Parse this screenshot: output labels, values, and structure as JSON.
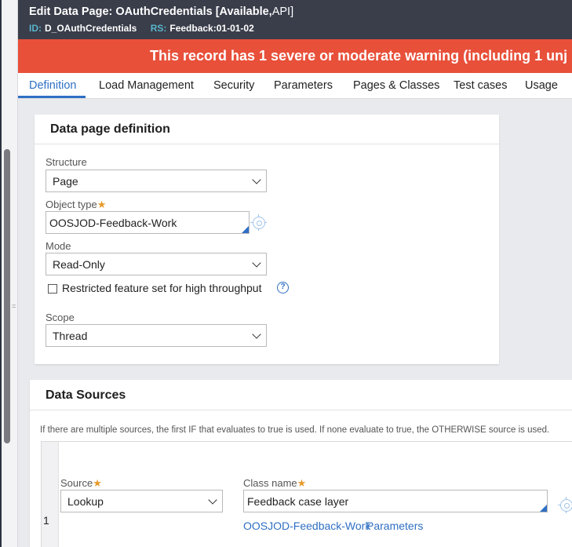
{
  "header": {
    "edit_label": "Edit",
    "rule_type": "Data Page:",
    "rule_name": "OAuthCredentials",
    "status_open": "[Available,",
    "status_api": "API]",
    "id_key": "ID:",
    "id_value": "D_OAuthCredentials",
    "rs_key": "RS:",
    "rs_value": "Feedback:01-01-02"
  },
  "warning_banner": "This record has 1 severe or moderate warning (including 1 unj",
  "tabs": [
    {
      "label": "Definition"
    },
    {
      "label": "Load Management"
    },
    {
      "label": "Security"
    },
    {
      "label": "Parameters"
    },
    {
      "label": "Pages & Classes"
    },
    {
      "label": "Test cases"
    },
    {
      "label": "Usage"
    }
  ],
  "definition_card": {
    "title": "Data page definition",
    "structure_label": "Structure",
    "structure_value": "Page",
    "object_type_label": "Object type",
    "object_type_value": "OOSJOD-Feedback-Work",
    "mode_label": "Mode",
    "mode_value": "Read-Only",
    "restricted_label": "Restricted feature set for high throughput",
    "help_glyph": "?",
    "scope_label": "Scope",
    "scope_value": "Thread"
  },
  "data_sources": {
    "title": "Data Sources",
    "info_text": "If there are multiple sources, the first IF that evaluates to true is used. If none evaluate to true, the OTHERWISE source is used.",
    "row_number": "1",
    "source_label": "Source",
    "source_value": "Lookup",
    "class_name_label": "Class name",
    "class_name_value": "Feedback case layer",
    "class_link": "OOSJOD-Feedback-Work",
    "parameters_link": "Parameters"
  },
  "required_marker": "★",
  "colors": {
    "header_bg": "#3a3d4a",
    "warning_bg": "#e8503a",
    "accent": "#2f6fc5",
    "required": "#e89a2c",
    "id_key": "#58b5c9"
  }
}
